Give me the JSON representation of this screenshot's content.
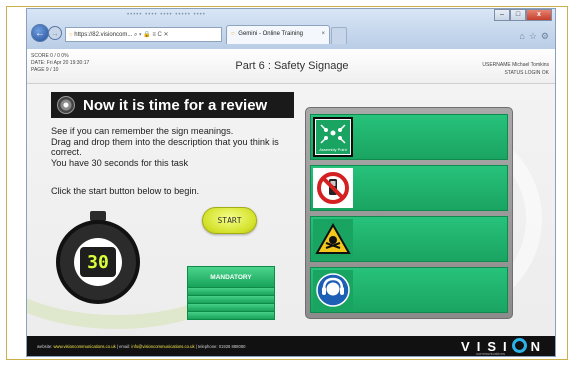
{
  "browser": {
    "address_url": "https://82.visioncom...",
    "address_controls": "⌕ ▾ 🔒 ≡ C ✕",
    "tab_title": "Gemini - Online Training",
    "tab_close": "×",
    "menu_hint": "••••• •••• •••• ••••• ••••",
    "window_controls": {
      "minimize": "–",
      "maximize": "□",
      "close": "x"
    },
    "tool_icons": {
      "home": "⌂",
      "favorites": "☆",
      "settings": "⚙"
    }
  },
  "header": {
    "score_line": "SCORE  0   /   0    0%",
    "date_line": "DATE:   Fri Apr 20 19:30:17",
    "page_line": "PAGE 9 / 10",
    "title": "Part 6 : Safety Signage",
    "username_line": "USERNAME   Michael Tomkins",
    "status_line": "STATUS   LOGIN OK"
  },
  "review": {
    "heading": "Now it is time for a review",
    "lines": [
      "See if you can remember the sign meanings.",
      "Drag and drop them into the description that you think is correct.",
      "You have 30 seconds for this task"
    ],
    "start_hint": "Click the start button below to begin."
  },
  "timer": {
    "value": "30"
  },
  "start_button": {
    "label": "START"
  },
  "drag_items": {
    "mandatory_label": "MANDATORY"
  },
  "signs": [
    {
      "name": "assembly-point",
      "caption": "Assembly Point",
      "color": "#1aa461"
    },
    {
      "name": "no-mobile-phones",
      "color": "#d42020"
    },
    {
      "name": "toxic-hazard",
      "color": "#f3c81c"
    },
    {
      "name": "wear-ear-protection",
      "color": "#1e5fb6"
    }
  ],
  "footer": {
    "website_label": "website: ",
    "website_value": "www.visioncommunications.co.uk",
    "email_label": " | email: ",
    "email_value": "info@visioncommunications.co.uk",
    "phone_label": " | telephone: ",
    "phone_value": "01926 888080",
    "logo_pre": "VISI",
    "logo_post": "N",
    "logo_sub": "communications"
  }
}
